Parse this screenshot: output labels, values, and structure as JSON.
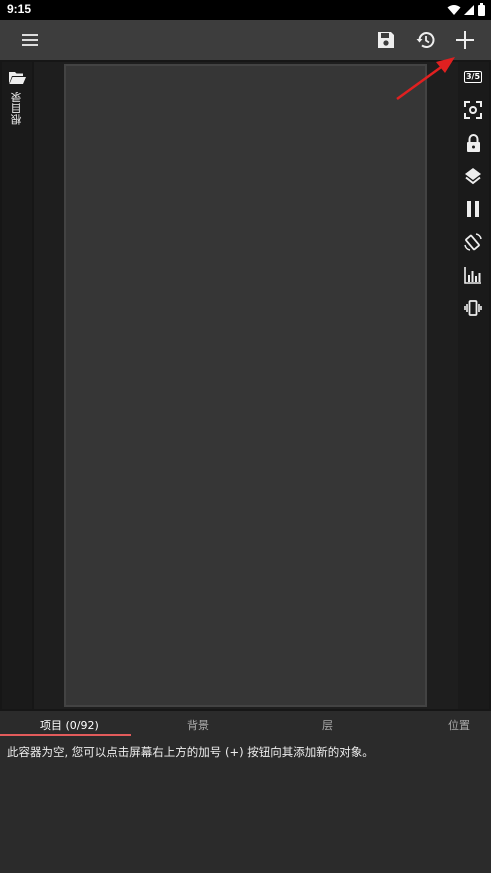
{
  "status_bar": {
    "time": "9:15",
    "icons": [
      "wifi-icon",
      "signal-icon",
      "battery-icon"
    ]
  },
  "toolbar": {
    "menu_icon": "hamburger-menu-icon",
    "save_icon": "save-icon",
    "history_icon": "history-icon",
    "add_icon": "plus-icon"
  },
  "left_panel": {
    "folder_icon": "folder-open-icon",
    "label": "根目录"
  },
  "right_panel": {
    "items": [
      {
        "icon": "display-badge-icon",
        "label": "3/5"
      },
      {
        "icon": "screenshot-focus-icon"
      },
      {
        "icon": "lock-icon"
      },
      {
        "icon": "layers-icon"
      },
      {
        "icon": "pause-icon"
      },
      {
        "icon": "screen-rotation-icon"
      },
      {
        "icon": "bar-chart-icon"
      },
      {
        "icon": "vibration-icon"
      }
    ]
  },
  "tabs": {
    "items": [
      "项目 (0/92)",
      "背景",
      "层",
      "位置"
    ],
    "active_index": 0
  },
  "content": {
    "empty_message": "此容器为空, 您可以点击屏幕右上方的加号 (+) 按钮向其添加新的对象。"
  },
  "colors": {
    "accent_underline": "#e25b5b",
    "annotation_arrow": "#e02020",
    "toolbar_bg": "#3d3d3d",
    "canvas_bg": "#363636"
  }
}
